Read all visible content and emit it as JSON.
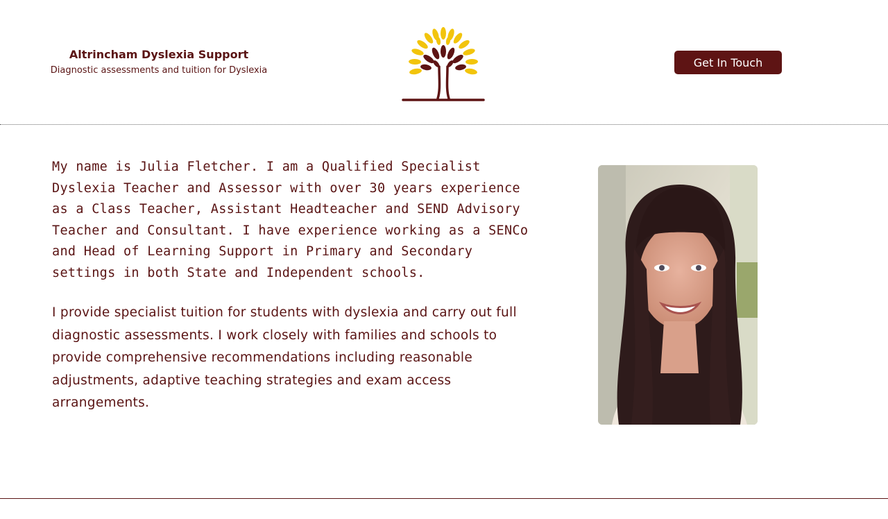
{
  "header": {
    "brand_name": "Altrincham Dyslexia Support",
    "brand_tagline": "Diagnostic assessments and tuition for Dyslexia",
    "logo_icon": "tree-logo-icon",
    "cta_label": "Get In Touch"
  },
  "main": {
    "paragraphs": [
      "My name is Julia Fletcher. I am a Qualified Specialist Dyslexia Teacher and Assessor with over 30 years experience as a Class Teacher, Assistant Headteacher and SEND Advisory Teacher and Consultant. I have experience working as a SENCo and Head of Learning Support in Primary and Secondary settings in both State and Independent schools.",
      "I provide specialist tuition for students with dyslexia and carry out full diagnostic assessments. I work closely with families and schools to provide comprehensive recommendations including reasonable adjustments, adaptive teaching strategies and exam access arrangements."
    ],
    "portrait_icon": "portrait-photo"
  },
  "colors": {
    "brand": "#5e1414",
    "text": "#5a1414",
    "leaf_yellow": "#f2c40c",
    "background": "#ffffff"
  }
}
